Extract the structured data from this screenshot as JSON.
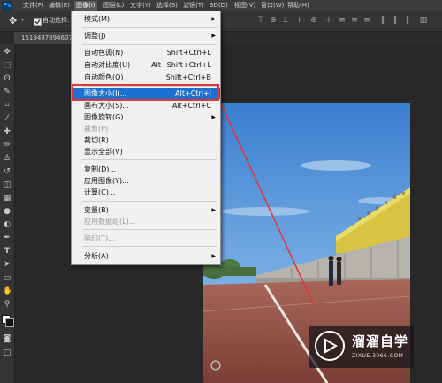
{
  "app": {
    "logo": "Ps"
  },
  "menubar": {
    "items": [
      {
        "label": "文件(F)"
      },
      {
        "label": "编辑(E)"
      },
      {
        "label": "图像(I)"
      },
      {
        "label": "图层(L)"
      },
      {
        "label": "文字(Y)"
      },
      {
        "label": "选择(S)"
      },
      {
        "label": "滤镜(T)"
      },
      {
        "label": "3D(D)"
      },
      {
        "label": "视图(V)"
      },
      {
        "label": "窗口(W)"
      },
      {
        "label": "帮助(H)"
      }
    ]
  },
  "options": {
    "auto_select_label": "自动选择:",
    "auto_select_checked": true
  },
  "document": {
    "tab_name": "1519487894607"
  },
  "image_menu": {
    "items": [
      {
        "label": "模式(M)",
        "submenu": true
      },
      {
        "label": "调整(J)",
        "submenu": true
      },
      {
        "label": "自动色调(N)",
        "shortcut": "Shift+Ctrl+L"
      },
      {
        "label": "自动对比度(U)",
        "shortcut": "Alt+Shift+Ctrl+L"
      },
      {
        "label": "自动颜色(O)",
        "shortcut": "Shift+Ctrl+B"
      },
      {
        "label": "图像大小(I)...",
        "shortcut": "Alt+Ctrl+I"
      },
      {
        "label": "画布大小(S)...",
        "shortcut": "Alt+Ctrl+C"
      },
      {
        "label": "图像旋转(G)",
        "submenu": true
      },
      {
        "label": "裁剪(P)"
      },
      {
        "label": "裁切(R)..."
      },
      {
        "label": "显示全部(V)"
      },
      {
        "label": "复制(D)..."
      },
      {
        "label": "应用图像(Y)..."
      },
      {
        "label": "计算(C)..."
      },
      {
        "label": "变量(B)",
        "submenu": true
      },
      {
        "label": "应用数据组(L)..."
      },
      {
        "label": "陷印(T)..."
      },
      {
        "label": "分析(A)",
        "submenu": true
      }
    ],
    "highlighted": "图像大小(I)..."
  },
  "watermark": {
    "title": "溜溜自学",
    "url": "ZIXUE.3066.COM"
  },
  "colors": {
    "highlight": "#1e70d0",
    "annotation": "#e2353a",
    "ps_blue": "#31a8ff"
  }
}
